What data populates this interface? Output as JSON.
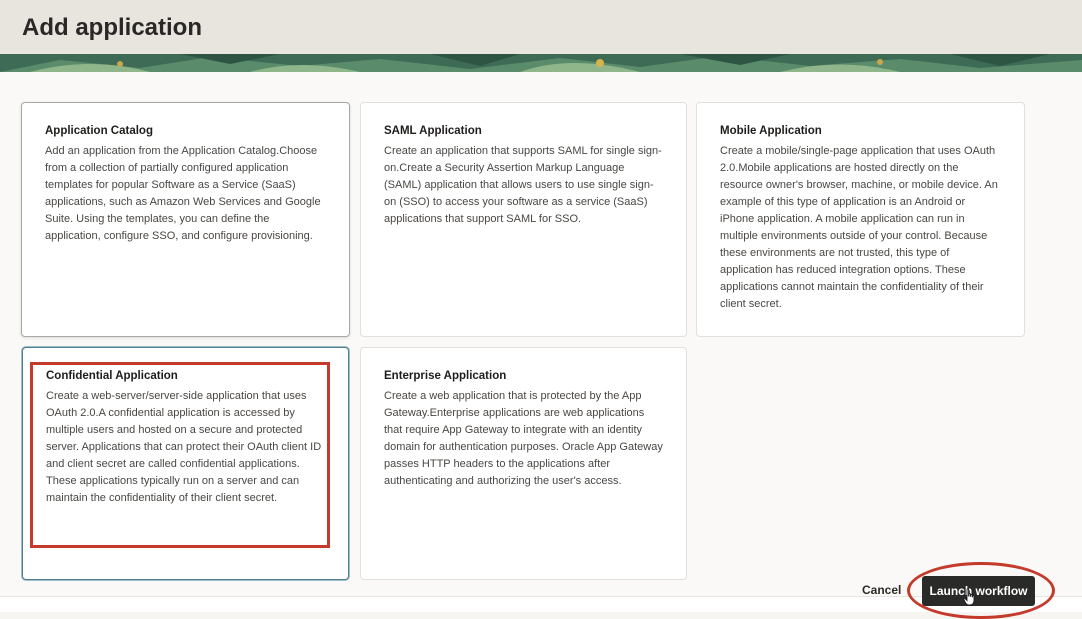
{
  "header": {
    "title": "Add application"
  },
  "cards": [
    {
      "title": "Application Catalog",
      "description": "Add an application from the Application Catalog.Choose from a collection of partially configured application templates for popular Software as a Service (SaaS) applications, such as Amazon Web Services and Google Suite. Using the templates, you can define the application, configure SSO, and configure provisioning."
    },
    {
      "title": "SAML Application",
      "description": "Create an application that supports SAML for single sign-on.Create a Security Assertion Markup Language (SAML) application that allows users to use single sign-on (SSO) to access your software as a service (SaaS) applications that support SAML for SSO."
    },
    {
      "title": "Mobile Application",
      "description": "Create a mobile/single-page application that uses OAuth 2.0.Mobile applications are hosted directly on the resource owner's browser, machine, or mobile device. An example of this type of application is an Android or iPhone application. A mobile application can run in multiple environments outside of your control. Because these environments are not trusted, this type of application has reduced integration options. These applications cannot maintain the confidentiality of their client secret."
    },
    {
      "title": "Confidential Application",
      "description": "Create a web-server/server-side application that uses OAuth 2.0.A confidential application is accessed by multiple users and hosted on a secure and protected server. Applications that can protect their OAuth client ID and client secret are called confidential applications. These applications typically run on a server and can maintain the confidentiality of their client secret."
    },
    {
      "title": "Enterprise Application",
      "description": "Create a web application that is protected by the App Gateway.Enterprise applications are web applications that require App Gateway to integrate with an identity domain for authentication purposes. Oracle App Gateway passes HTTP headers to the applications after authenticating and authorizing the user's access."
    }
  ],
  "footer": {
    "cancel_label": "Cancel",
    "launch_label": "Launch workflow"
  },
  "selected_card": "Confidential Application",
  "colors": {
    "annotation": "#c43a2b",
    "selected_border": "#4f7f92",
    "primary_button": "#2a2a28"
  }
}
